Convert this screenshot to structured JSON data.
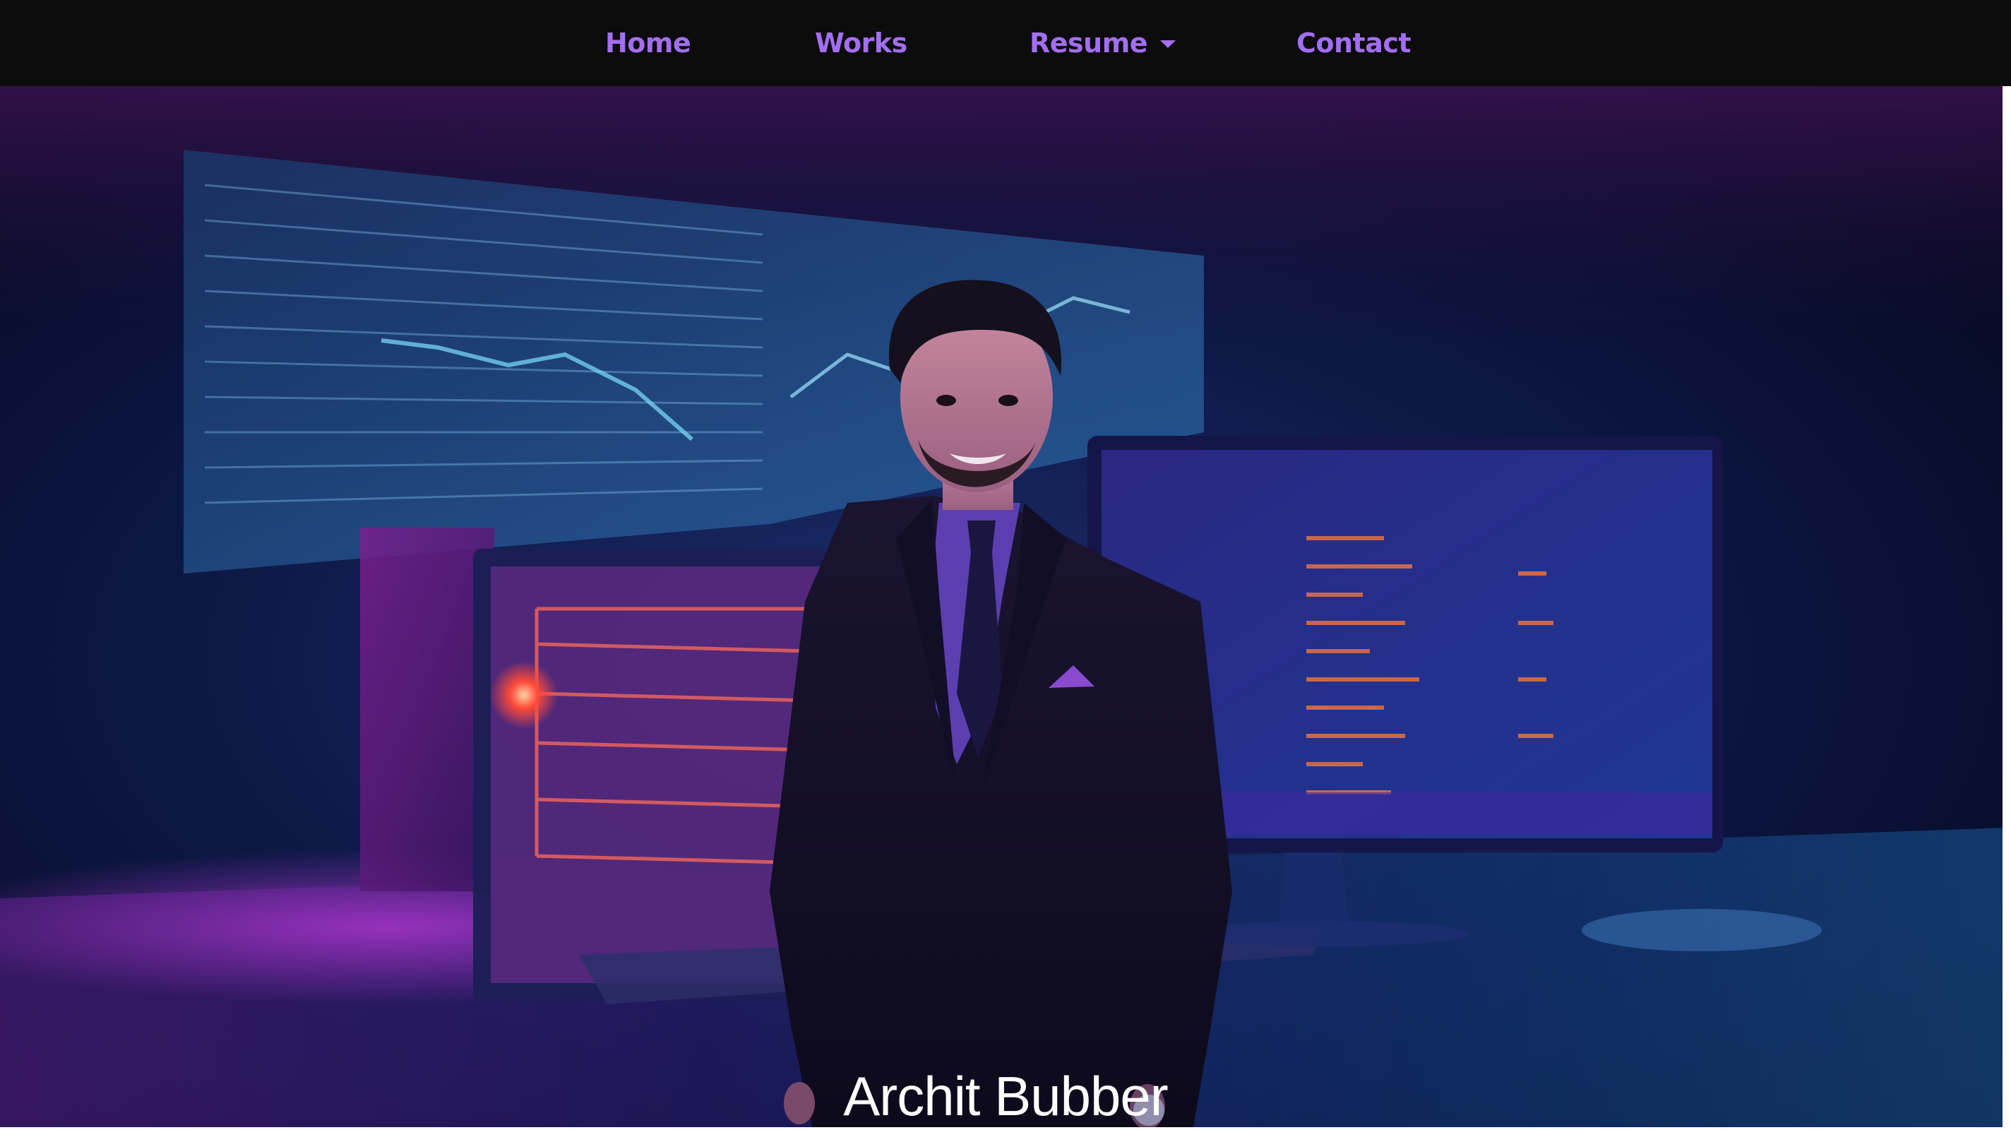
{
  "nav": {
    "home": "Home",
    "works": "Works",
    "resume": "Resume",
    "contact": "Contact"
  },
  "hero": {
    "name": "Archit Bubber"
  },
  "colors": {
    "nav_background": "#0c0c0d",
    "nav_link": "#a36ef2",
    "hero_text": "#ffffff"
  }
}
